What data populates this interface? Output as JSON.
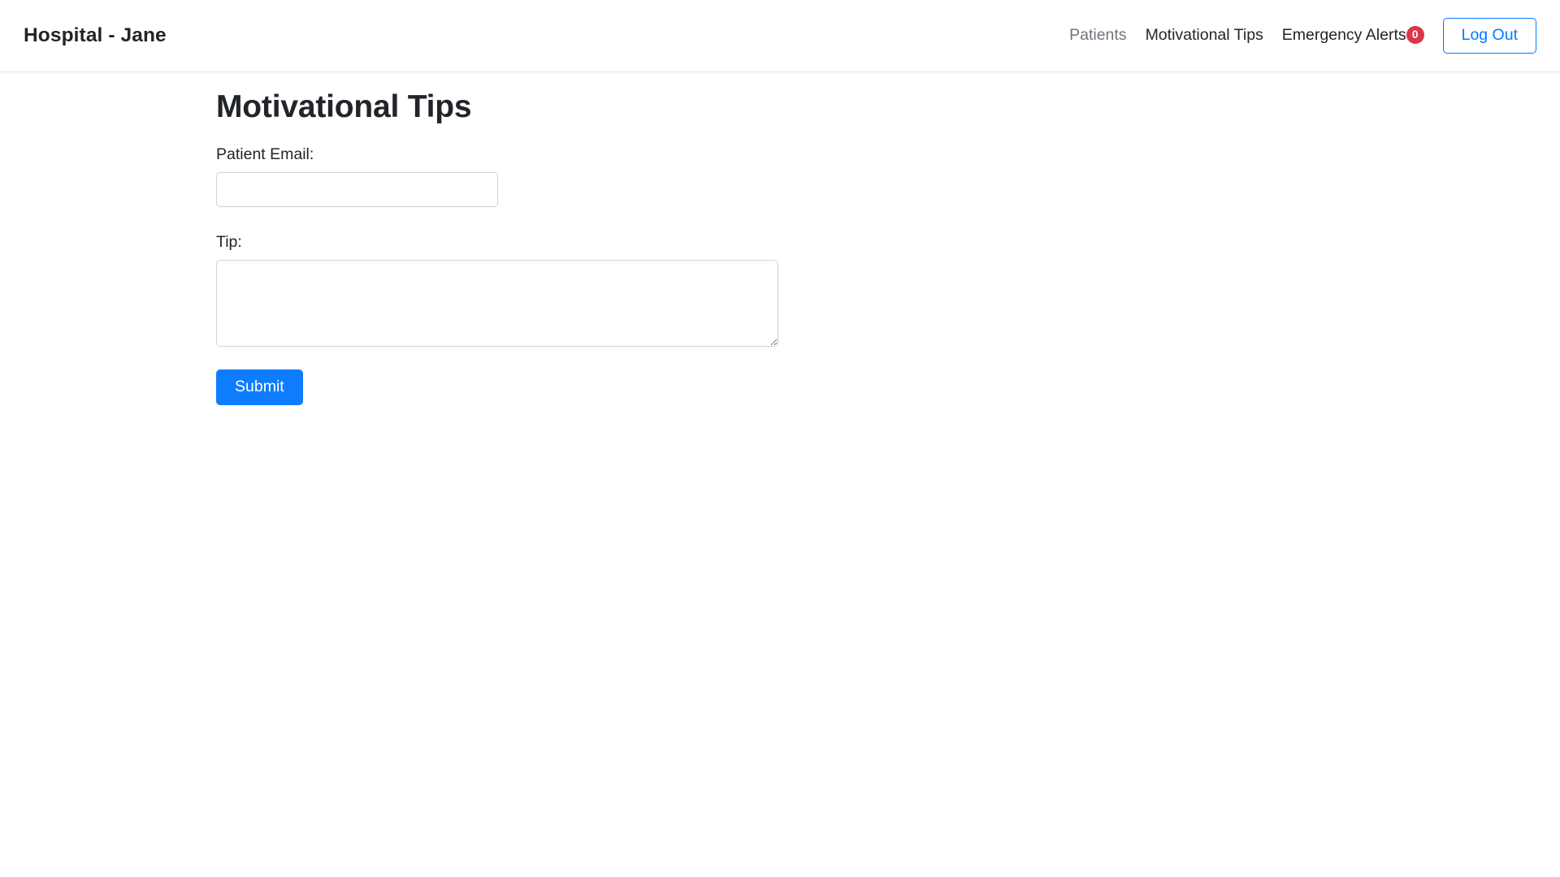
{
  "navbar": {
    "brand": "Hospital - Jane",
    "links": [
      {
        "label": "Patients",
        "active": false
      },
      {
        "label": "Motivational Tips",
        "active": true
      }
    ],
    "alerts": {
      "label": "Emergency Alerts",
      "count": "0",
      "badge_color": "#dc3545"
    },
    "logout_label": "Log Out",
    "accent_color": "#007bff"
  },
  "main": {
    "title": "Motivational Tips",
    "form": {
      "email_label": "Patient Email:",
      "email_value": "",
      "email_placeholder": "",
      "tip_label": "Tip:",
      "tip_value": "",
      "tip_placeholder": "",
      "submit_label": "Submit",
      "submit_color": "#0d7dfe"
    }
  }
}
